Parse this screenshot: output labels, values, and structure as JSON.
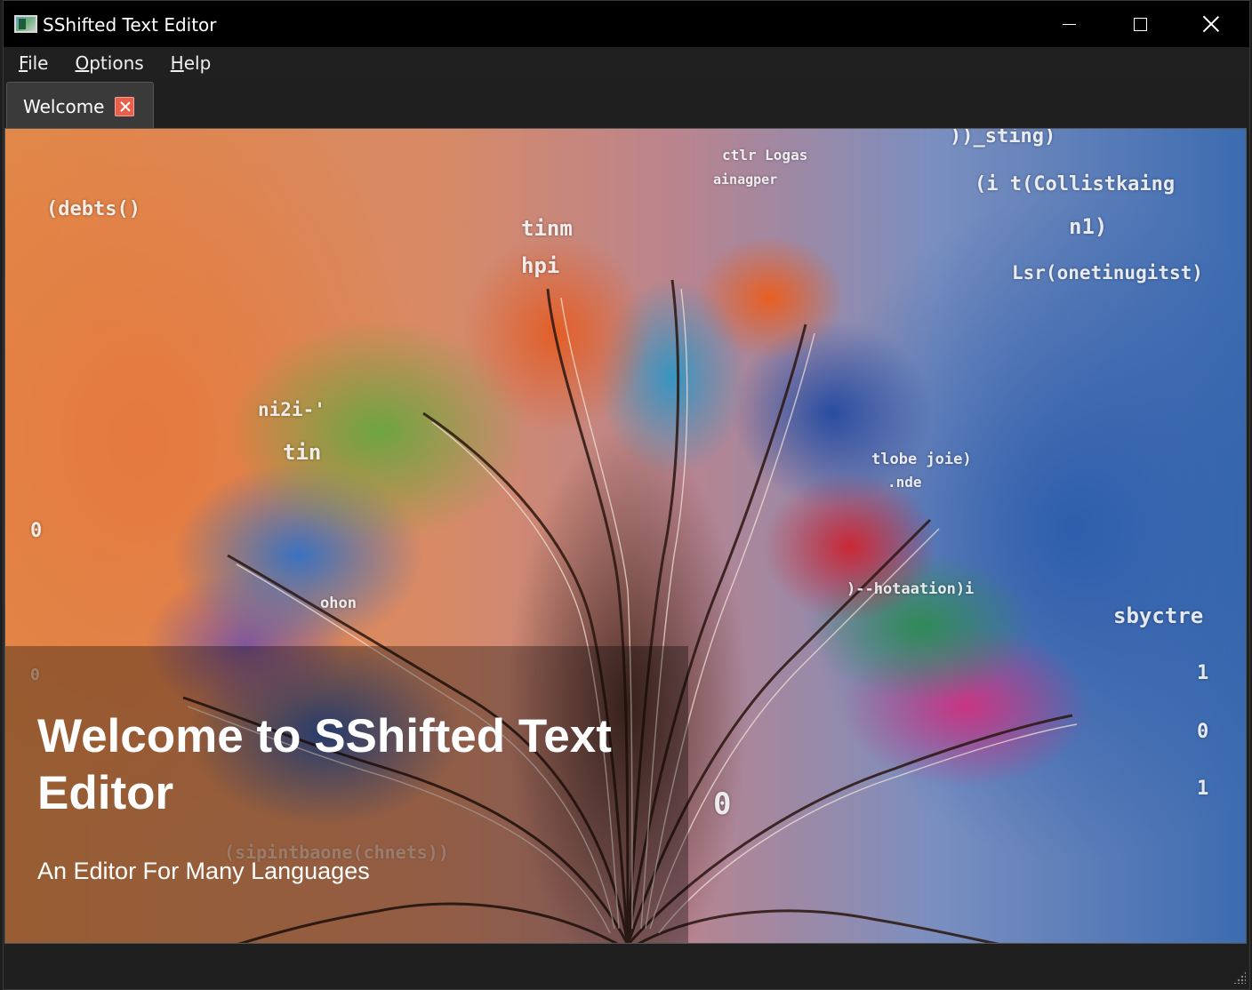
{
  "window": {
    "title": "SShifted Text Editor",
    "icon": "app-icon",
    "controls": [
      "minimize-icon",
      "maximize-icon",
      "close-icon"
    ]
  },
  "menu": {
    "items": [
      {
        "accel": "F",
        "rest": "ile"
      },
      {
        "accel": "O",
        "rest": "ptions"
      },
      {
        "accel": "H",
        "rest": "elp"
      }
    ]
  },
  "tabs": [
    {
      "label": "Welcome",
      "close_icon": "close-icon",
      "close_color": "#e8604c"
    }
  ],
  "welcome": {
    "title": "Welcome to SShifted Text Editor",
    "subtitle": "An Editor For Many Languages",
    "artwork_text": [
      "(debts()",
      "))_sting)",
      "(i  t(Collistkaing",
      "ctlr Logas",
      "ainagper",
      "tinm",
      "hpi",
      "n1)",
      "Lsr(onetinugitst)",
      "ni2i-'",
      "tin",
      "ohon",
      "tlobe  joie)",
      ".nde",
      ")--hotaation)i",
      "sbyctre",
      "(sipintbaone(chnets))",
      "0",
      "1",
      "0",
      "1",
      "0",
      "0"
    ]
  },
  "colors": {
    "titlebar": "#000000",
    "chrome": "#1f1f1f",
    "tab_active": "#3a3a3a",
    "text": "#ffffff"
  }
}
